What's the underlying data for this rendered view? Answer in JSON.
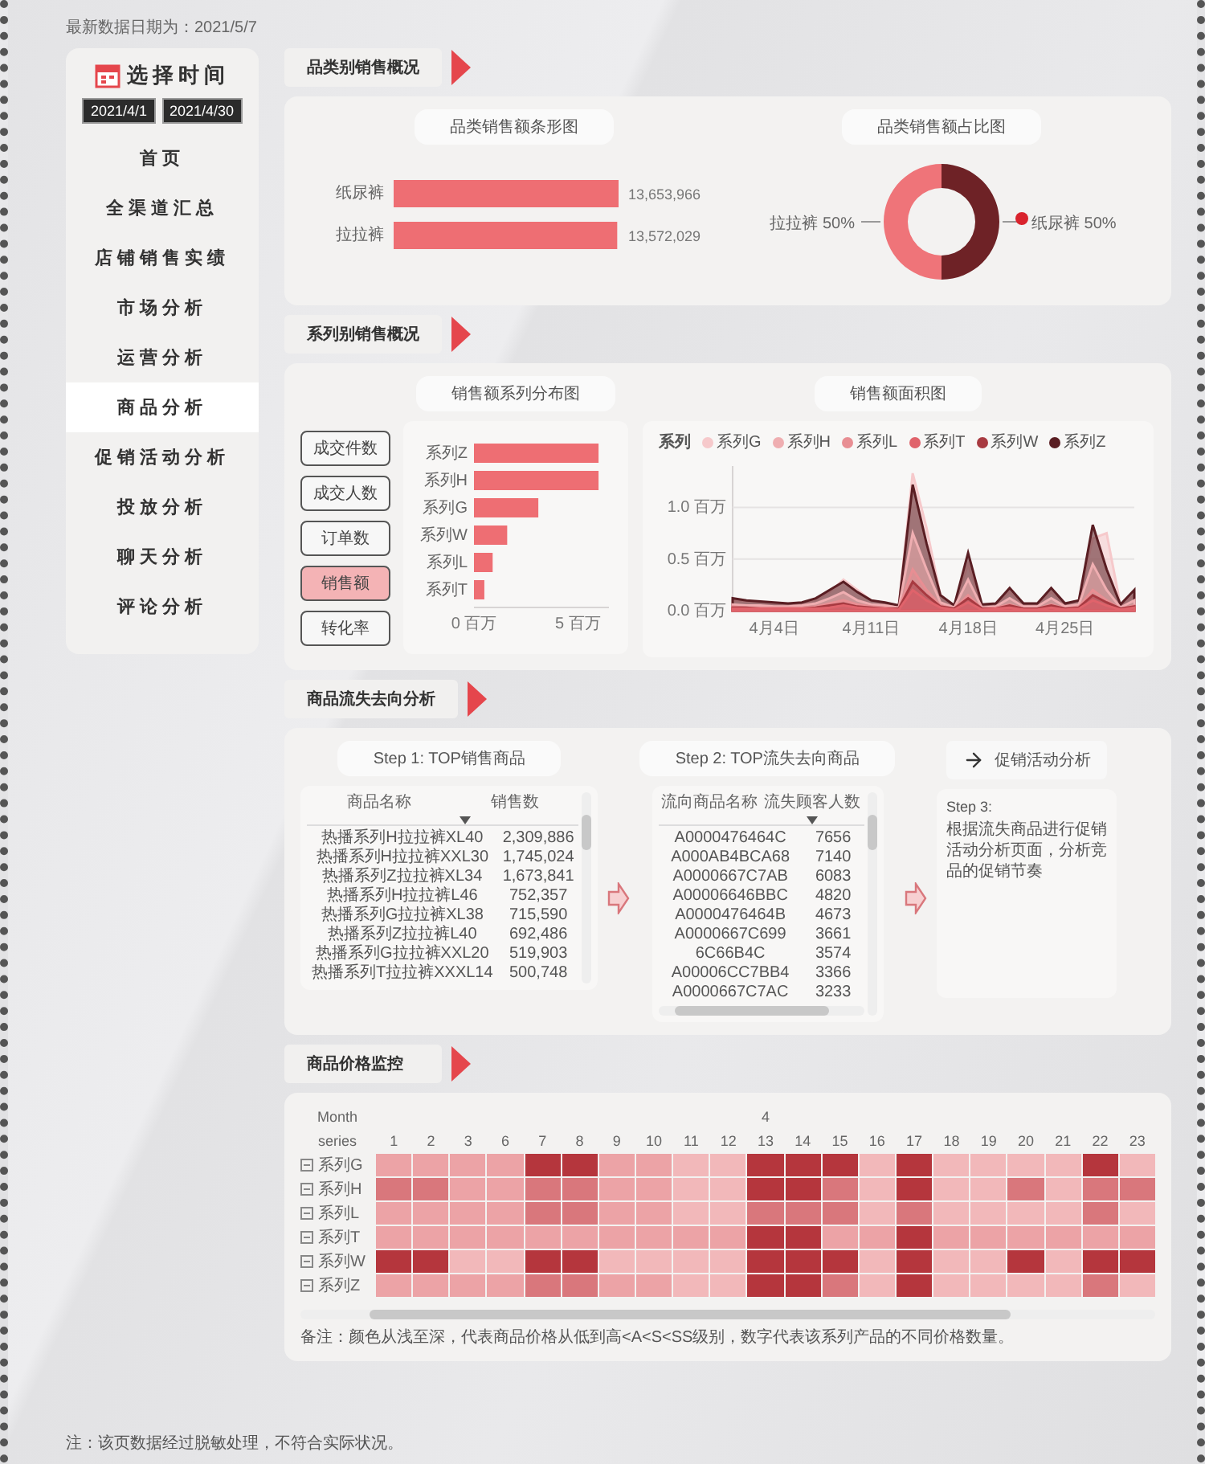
{
  "updated": "最新数据日期为：2021/5/7",
  "sidebar": {
    "title": "选择时间",
    "dates": [
      "2021/4/1",
      "2021/4/30"
    ],
    "items": [
      {
        "label": "首页",
        "selected": false
      },
      {
        "label": "全渠道汇总",
        "selected": false
      },
      {
        "label": "店铺销售实绩",
        "selected": false
      },
      {
        "label": "市场分析",
        "selected": false
      },
      {
        "label": "运营分析",
        "selected": false
      },
      {
        "label": "商品分析",
        "selected": true
      },
      {
        "label": "促销活动分析",
        "selected": false
      },
      {
        "label": "投放分析",
        "selected": false
      },
      {
        "label": "聊天分析",
        "selected": false
      },
      {
        "label": "评论分析",
        "selected": false
      }
    ]
  },
  "category_sales": {
    "heading": "品类别销售概况",
    "bar": {
      "title": "品类销售额条形图",
      "chart_data": {
        "type": "bar",
        "orientation": "horizontal",
        "categories": [
          "纸尿裤",
          "拉拉裤"
        ],
        "values": [
          13653966,
          13572029
        ],
        "value_labels": [
          "13,653,966",
          "13,572,029"
        ],
        "color": "#ee6e73"
      }
    },
    "donut": {
      "title": "品类销售额占比图",
      "chart_data": {
        "type": "donut",
        "categories": [
          "纸尿裤",
          "拉拉裤"
        ],
        "values": [
          50,
          50
        ],
        "colors": [
          "#6e2226",
          "#ef7479"
        ],
        "value_labels": [
          "50%",
          "50%"
        ]
      }
    }
  },
  "series_sales": {
    "heading": "系列别销售概况",
    "metrics": [
      {
        "label": "成交件数",
        "selected": false
      },
      {
        "label": "成交人数",
        "selected": false
      },
      {
        "label": "订单数",
        "selected": false
      },
      {
        "label": "销售额",
        "selected": true
      },
      {
        "label": "转化率",
        "selected": false
      }
    ],
    "bar": {
      "title": "销售额系列分布图",
      "chart_data": {
        "type": "bar",
        "orientation": "horizontal",
        "categories": [
          "系列Z",
          "系列H",
          "系列G",
          "系列W",
          "系列L",
          "系列T"
        ],
        "values": [
          6.0,
          6.0,
          3.1,
          1.6,
          0.9,
          0.5
        ],
        "xlim": [
          0,
          6.5
        ],
        "xticks": [
          {
            "value": 0,
            "label": "0 百万"
          },
          {
            "value": 5,
            "label": "5 百万"
          }
        ],
        "color": "#ee6e73"
      }
    },
    "area": {
      "title": "销售额面积图",
      "legend_title": "系列",
      "chart_data": {
        "type": "area",
        "categories": [
          null,
          null,
          null,
          "4月4日",
          null,
          null,
          null,
          null,
          null,
          null,
          "4月11日",
          null,
          null,
          null,
          null,
          null,
          null,
          "4月18日",
          null,
          null,
          null,
          null,
          null,
          null,
          "4月25日",
          null,
          null,
          null,
          null,
          null
        ],
        "ylim": [
          0,
          1.4
        ],
        "yticks": [
          {
            "value": 0,
            "label": "0.0 百万"
          },
          {
            "value": 0.5,
            "label": "0.5 百万"
          },
          {
            "value": 1.0,
            "label": "1.0 百万"
          }
        ],
        "series": [
          {
            "name": "系列G",
            "color": "#f6c9cb",
            "values": [
              0.1,
              0.09,
              0.08,
              0.07,
              0.06,
              0.07,
              0.1,
              0.18,
              0.3,
              0.2,
              0.1,
              0.07,
              0.05,
              1.33,
              0.8,
              0.15,
              0.05,
              0.45,
              0.05,
              0.06,
              0.18,
              0.06,
              0.06,
              0.18,
              0.06,
              0.1,
              0.7,
              0.75,
              0.05,
              0.15
            ]
          },
          {
            "name": "系列H",
            "color": "#efaeb1",
            "values": [
              0.06,
              0.05,
              0.05,
              0.04,
              0.04,
              0.05,
              0.07,
              0.12,
              0.18,
              0.1,
              0.06,
              0.05,
              0.03,
              0.75,
              0.4,
              0.08,
              0.03,
              0.3,
              0.03,
              0.04,
              0.12,
              0.04,
              0.04,
              0.12,
              0.04,
              0.06,
              0.45,
              0.2,
              0.03,
              0.1
            ]
          },
          {
            "name": "系列L",
            "color": "#e88e93",
            "values": [
              0.04,
              0.03,
              0.03,
              0.03,
              0.03,
              0.03,
              0.04,
              0.07,
              0.1,
              0.06,
              0.04,
              0.03,
              0.02,
              0.4,
              0.2,
              0.05,
              0.02,
              0.15,
              0.02,
              0.03,
              0.06,
              0.02,
              0.02,
              0.06,
              0.02,
              0.04,
              0.2,
              0.1,
              0.02,
              0.05
            ]
          },
          {
            "name": "系列T",
            "color": "#e0636b",
            "values": [
              0.02,
              0.02,
              0.02,
              0.02,
              0.02,
              0.02,
              0.02,
              0.03,
              0.05,
              0.03,
              0.02,
              0.02,
              0.01,
              0.2,
              0.1,
              0.03,
              0.01,
              0.08,
              0.01,
              0.02,
              0.03,
              0.01,
              0.01,
              0.03,
              0.01,
              0.02,
              0.1,
              0.05,
              0.01,
              0.03
            ]
          },
          {
            "name": "系列W",
            "color": "#a83a41",
            "values": [
              0.03,
              0.03,
              0.02,
              0.02,
              0.02,
              0.02,
              0.03,
              0.05,
              0.07,
              0.04,
              0.03,
              0.02,
              0.02,
              0.28,
              0.15,
              0.04,
              0.02,
              0.12,
              0.02,
              0.02,
              0.05,
              0.02,
              0.02,
              0.05,
              0.02,
              0.03,
              0.15,
              0.08,
              0.02,
              0.04
            ]
          },
          {
            "name": "系列Z",
            "color": "#5a1e23",
            "values": [
              0.12,
              0.1,
              0.09,
              0.08,
              0.07,
              0.08,
              0.12,
              0.2,
              0.28,
              0.18,
              0.1,
              0.08,
              0.05,
              1.22,
              0.65,
              0.15,
              0.05,
              0.56,
              0.06,
              0.07,
              0.22,
              0.07,
              0.07,
              0.22,
              0.07,
              0.1,
              0.83,
              0.4,
              0.06,
              0.2
            ]
          }
        ]
      }
    }
  },
  "churn": {
    "heading": "商品流失去向分析",
    "step1": {
      "title": "Step 1: TOP销售商品",
      "columns": [
        "商品名称",
        "销售数"
      ],
      "rows": [
        [
          "热播系列H拉拉裤XL40",
          "2,309,886"
        ],
        [
          "热播系列H拉拉裤XXL30",
          "1,745,024"
        ],
        [
          "热播系列Z拉拉裤XL34",
          "1,673,841"
        ],
        [
          "热播系列H拉拉裤L46",
          "752,357"
        ],
        [
          "热播系列G拉拉裤XL38",
          "715,590"
        ],
        [
          "热播系列Z拉拉裤L40",
          "692,486"
        ],
        [
          "热播系列G拉拉裤XXL20",
          "519,903"
        ],
        [
          "热播系列T拉拉裤XXXL14",
          "500,748"
        ]
      ]
    },
    "step2": {
      "title": "Step 2: TOP流失去向商品",
      "columns": [
        "流向商品名称",
        "流失顾客人数"
      ],
      "rows": [
        [
          "A0000476464C",
          "7656"
        ],
        [
          "A000AB4BCA68",
          "7140"
        ],
        [
          "A0000667C7AB",
          "6083"
        ],
        [
          "A00006646BBC",
          "4820"
        ],
        [
          "A0000476464B",
          "4673"
        ],
        [
          "A0000667C699",
          "3661"
        ],
        [
          "6C66B4C",
          "3574"
        ],
        [
          "A00006CC7BB4",
          "3366"
        ],
        [
          "A0000667C7AC",
          "3233"
        ]
      ]
    },
    "link": "促销活动分析",
    "step3": {
      "label": "Step 3:",
      "text": "根据流失商品进行促销活动分析页面，分析竞品的促销节奏"
    }
  },
  "price": {
    "heading": "商品价格监控",
    "month_label": "Month",
    "month": "4",
    "series_label": "series",
    "days": [
      "1",
      "2",
      "3",
      "6",
      "7",
      "8",
      "9",
      "10",
      "11",
      "12",
      "13",
      "14",
      "15",
      "16",
      "17",
      "18",
      "19",
      "20",
      "21",
      "22",
      "23"
    ],
    "rows": [
      {
        "name": "系列G",
        "cells": [
          {
            "color": "#eca3a6"
          },
          {
            "color": "#eca3a6"
          },
          {
            "color": "#eca3a6"
          },
          {
            "color": "#eca3a6"
          },
          {
            "color": "#b5363d"
          },
          {
            "color": "#b5363d"
          },
          {
            "color": "#eca3a6"
          },
          {
            "color": "#eca3a6"
          },
          {
            "color": "#f2b8ba"
          },
          {
            "color": "#f2b8ba"
          },
          {
            "color": "#b5363d"
          },
          {
            "color": "#b5363d"
          },
          {
            "color": "#b5363d"
          },
          {
            "color": "#f2b8ba"
          },
          {
            "color": "#b5363d"
          },
          {
            "color": "#f2b8ba"
          },
          {
            "color": "#f2b8ba"
          },
          {
            "color": "#f2b8ba"
          },
          {
            "color": "#f2b8ba"
          },
          {
            "color": "#b5363d"
          },
          {
            "color": "#f2b8ba"
          }
        ]
      },
      {
        "name": "系列H",
        "cells": [
          {
            "color": "#d9777c"
          },
          {
            "color": "#d9777c"
          },
          {
            "color": "#eca3a6"
          },
          {
            "color": "#eca3a6"
          },
          {
            "color": "#d9777c"
          },
          {
            "color": "#d9777c"
          },
          {
            "color": "#eca3a6"
          },
          {
            "color": "#eca3a6"
          },
          {
            "color": "#f2b8ba"
          },
          {
            "color": "#f2b8ba"
          },
          {
            "color": "#b5363d"
          },
          {
            "color": "#b5363d"
          },
          {
            "color": "#d9777c"
          },
          {
            "color": "#f2b8ba"
          },
          {
            "color": "#b5363d"
          },
          {
            "color": "#f2b8ba"
          },
          {
            "color": "#f2b8ba"
          },
          {
            "color": "#d9777c"
          },
          {
            "color": "#f2b8ba"
          },
          {
            "color": "#d9777c"
          },
          {
            "color": "#d9777c"
          }
        ]
      },
      {
        "name": "系列L",
        "cells": [
          {
            "color": "#eca3a6"
          },
          {
            "color": "#eca3a6"
          },
          {
            "color": "#eca3a6"
          },
          {
            "color": "#eca3a6"
          },
          {
            "color": "#d9777c"
          },
          {
            "color": "#d9777c"
          },
          {
            "color": "#eca3a6"
          },
          {
            "color": "#eca3a6"
          },
          {
            "color": "#f2b8ba"
          },
          {
            "color": "#f2b8ba"
          },
          {
            "color": "#d9777c"
          },
          {
            "color": "#d9777c"
          },
          {
            "color": "#d9777c"
          },
          {
            "color": "#f2b8ba"
          },
          {
            "color": "#d9777c"
          },
          {
            "color": "#f2b8ba"
          },
          {
            "color": "#f2b8ba"
          },
          {
            "color": "#f2b8ba"
          },
          {
            "color": "#f2b8ba"
          },
          {
            "color": "#d9777c"
          },
          {
            "color": "#f2b8ba"
          }
        ]
      },
      {
        "name": "系列T",
        "cells": [
          {
            "color": "#eca3a6"
          },
          {
            "color": "#eca3a6"
          },
          {
            "color": "#eca3a6"
          },
          {
            "color": "#eca3a6"
          },
          {
            "color": "#eca3a6"
          },
          {
            "color": "#eca3a6"
          },
          {
            "color": "#eca3a6"
          },
          {
            "color": "#eca3a6"
          },
          {
            "color": "#eca3a6"
          },
          {
            "color": "#eca3a6"
          },
          {
            "color": "#b5363d"
          },
          {
            "color": "#b5363d"
          },
          {
            "color": "#eca3a6"
          },
          {
            "color": "#eca3a6"
          },
          {
            "color": "#b5363d"
          },
          {
            "color": "#eca3a6"
          },
          {
            "color": "#eca3a6"
          },
          {
            "color": "#eca3a6"
          },
          {
            "color": "#eca3a6"
          },
          {
            "color": "#eca3a6"
          },
          {
            "color": "#eca3a6"
          }
        ]
      },
      {
        "name": "系列W",
        "cells": [
          {
            "color": "#b5363d"
          },
          {
            "color": "#b5363d"
          },
          {
            "color": "#f2b8ba"
          },
          {
            "color": "#f2b8ba"
          },
          {
            "color": "#b5363d"
          },
          {
            "color": "#b5363d"
          },
          {
            "color": "#f2b8ba"
          },
          {
            "color": "#f2b8ba"
          },
          {
            "color": "#f2b8ba"
          },
          {
            "color": "#f2b8ba"
          },
          {
            "color": "#b5363d"
          },
          {
            "color": "#b5363d"
          },
          {
            "color": "#b5363d"
          },
          {
            "color": "#f2b8ba"
          },
          {
            "color": "#b5363d"
          },
          {
            "color": "#f2b8ba"
          },
          {
            "color": "#f2b8ba"
          },
          {
            "color": "#b5363d"
          },
          {
            "color": "#f2b8ba"
          },
          {
            "color": "#b5363d"
          },
          {
            "color": "#b5363d"
          }
        ]
      },
      {
        "name": "系列Z",
        "cells": [
          {
            "color": "#eca3a6"
          },
          {
            "color": "#eca3a6"
          },
          {
            "color": "#eca3a6"
          },
          {
            "color": "#eca3a6"
          },
          {
            "color": "#d9777c"
          },
          {
            "color": "#d9777c"
          },
          {
            "color": "#eca3a6"
          },
          {
            "color": "#eca3a6"
          },
          {
            "color": "#f2b8ba"
          },
          {
            "color": "#f2b8ba"
          },
          {
            "color": "#b5363d"
          },
          {
            "color": "#b5363d"
          },
          {
            "color": "#d9777c"
          },
          {
            "color": "#f2b8ba"
          },
          {
            "color": "#b5363d"
          },
          {
            "color": "#f2b8ba"
          },
          {
            "color": "#f2b8ba"
          },
          {
            "color": "#f2b8ba"
          },
          {
            "color": "#f2b8ba"
          },
          {
            "color": "#d9777c"
          },
          {
            "color": "#f2b8ba"
          }
        ]
      }
    ],
    "note": "备注：颜色从浅至深，代表商品价格从低到高<A<S<SS级别，数字代表该系列产品的不同价格数量。"
  },
  "footer": "注：该页数据经过脱敏处理，不符合实际状况。"
}
